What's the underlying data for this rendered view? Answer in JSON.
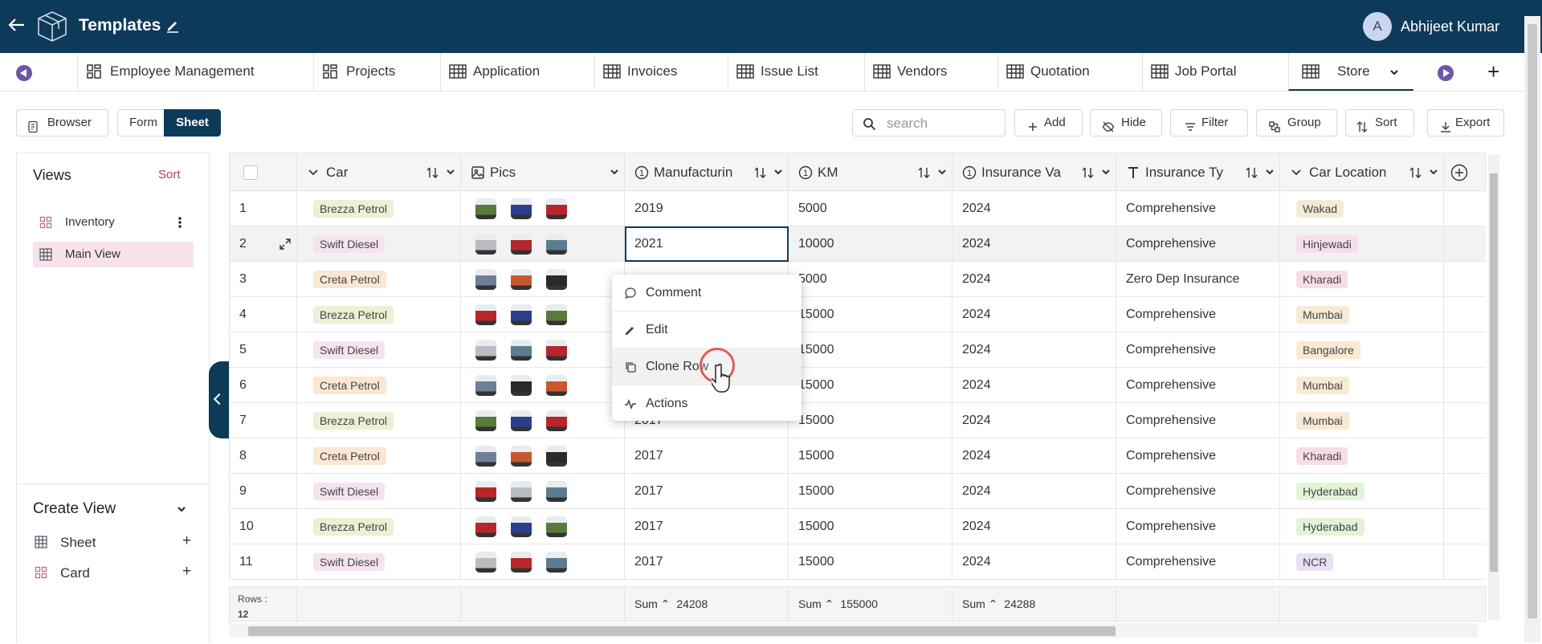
{
  "header": {
    "title": "Templates",
    "user_initial": "A",
    "user_name": "Abhijeet Kumar"
  },
  "tabs": [
    {
      "label": "Employee Management",
      "icon": "dashboard-icon"
    },
    {
      "label": "Projects",
      "icon": "dashboard-icon"
    },
    {
      "label": "Application",
      "icon": "table-icon"
    },
    {
      "label": "Invoices",
      "icon": "table-icon"
    },
    {
      "label": "Issue List",
      "icon": "table-icon"
    },
    {
      "label": "Vendors",
      "icon": "table-icon"
    },
    {
      "label": "Quotation",
      "icon": "table-icon"
    },
    {
      "label": "Job Portal",
      "icon": "table-icon"
    },
    {
      "label": "Store",
      "icon": "table-icon",
      "active": true
    }
  ],
  "toolbar": {
    "browser": "Browser",
    "form": "Form",
    "sheet": "Sheet",
    "search_placeholder": "search",
    "add": "Add",
    "hide": "Hide",
    "filter": "Filter",
    "group": "Group",
    "sort": "Sort",
    "export": "Export"
  },
  "views": {
    "heading": "Views",
    "sort": "Sort",
    "items": [
      {
        "label": "Inventory"
      },
      {
        "label": "Main View"
      }
    ],
    "create_heading": "Create View",
    "create_items": [
      {
        "label": "Sheet"
      },
      {
        "label": "Card"
      }
    ]
  },
  "columns": [
    "Car",
    "Pics",
    "Manufacturin",
    "KM",
    "Insurance Va",
    "Insurance Ty",
    "Car Location"
  ],
  "rows": [
    {
      "n": "1",
      "car": "Brezza Petrol",
      "pics": [
        "green",
        "blue",
        "red"
      ],
      "year": "2019",
      "km": "5000",
      "ins": "2024",
      "type": "Comprehensive",
      "loc": "Wakad"
    },
    {
      "n": "2",
      "car": "Swift Diesel",
      "pics": [
        "white",
        "red",
        "teal"
      ],
      "year": "2021",
      "km": "10000",
      "ins": "2024",
      "type": "Comprehensive",
      "loc": "Hinjewadi"
    },
    {
      "n": "3",
      "car": "Creta Petrol",
      "pics": [
        "steel",
        "orange",
        "black"
      ],
      "year": "",
      "km": "5000",
      "ins": "2024",
      "type": "Zero Dep Insurance",
      "loc": "Kharadi"
    },
    {
      "n": "4",
      "car": "Brezza Petrol",
      "pics": [
        "red",
        "blue",
        "green"
      ],
      "year": "",
      "km": "15000",
      "ins": "2024",
      "type": "Comprehensive",
      "loc": "Mumbai"
    },
    {
      "n": "5",
      "car": "Swift Diesel",
      "pics": [
        "white",
        "teal",
        "red"
      ],
      "year": "",
      "km": "15000",
      "ins": "2024",
      "type": "Comprehensive",
      "loc": "Bangalore"
    },
    {
      "n": "6",
      "car": "Creta Petrol",
      "pics": [
        "steel",
        "black",
        "orange"
      ],
      "year": "",
      "km": "15000",
      "ins": "2024",
      "type": "Comprehensive",
      "loc": "Mumbai"
    },
    {
      "n": "7",
      "car": "Brezza Petrol",
      "pics": [
        "green",
        "blue",
        "red"
      ],
      "year": "2017",
      "km": "15000",
      "ins": "2024",
      "type": "Comprehensive",
      "loc": "Mumbai"
    },
    {
      "n": "8",
      "car": "Creta Petrol",
      "pics": [
        "steel",
        "orange",
        "black"
      ],
      "year": "2017",
      "km": "15000",
      "ins": "2024",
      "type": "Comprehensive",
      "loc": "Kharadi"
    },
    {
      "n": "9",
      "car": "Swift Diesel",
      "pics": [
        "red",
        "white",
        "teal"
      ],
      "year": "2017",
      "km": "15000",
      "ins": "2024",
      "type": "Comprehensive",
      "loc": "Hyderabad"
    },
    {
      "n": "10",
      "car": "Brezza Petrol",
      "pics": [
        "red",
        "blue",
        "green"
      ],
      "year": "2017",
      "km": "15000",
      "ins": "2024",
      "type": "Comprehensive",
      "loc": "Hyderabad"
    },
    {
      "n": "11",
      "car": "Swift Diesel",
      "pics": [
        "white",
        "red",
        "teal"
      ],
      "year": "2017",
      "km": "15000",
      "ins": "2024",
      "type": "Comprehensive",
      "loc": "NCR"
    }
  ],
  "footer": {
    "rows_label": "Rows :",
    "rows_count": "12",
    "sum_label": "Sum",
    "sum_year": "24208",
    "sum_km": "155000",
    "sum_ins": "24288"
  },
  "context_menu": [
    {
      "label": "Comment",
      "icon": "comment-icon"
    },
    {
      "label": "Edit",
      "icon": "pencil-icon"
    },
    {
      "label": "Clone Row",
      "icon": "copy-icon"
    },
    {
      "label": "Actions",
      "icon": "activity-icon"
    }
  ],
  "colors": {
    "brand": "#0e3a5a",
    "accent": "#b23d6a",
    "view_selected": "#f8e2ea"
  },
  "tag_colors": {
    "Brezza Petrol": "#eeefd4",
    "Swift Diesel": "#f6e3f1",
    "Creta Petrol": "#fae7d3",
    "Wakad": "#f2ecd7",
    "Hinjewadi": "#f6deee",
    "Kharadi": "#f7dde9",
    "Mumbai": "#f8ead5",
    "Bangalore": "#fbe8d3",
    "Hyderabad": "#e2f3d8",
    "NCR": "#eadff5"
  },
  "pic_colors": {
    "green": "#5a7a3c",
    "blue": "#2b3f8e",
    "red": "#b8262a",
    "white": "#b9bcc0",
    "teal": "#5b7d8f",
    "steel": "#6e7f97",
    "orange": "#c9572c",
    "black": "#2a2a2a"
  }
}
